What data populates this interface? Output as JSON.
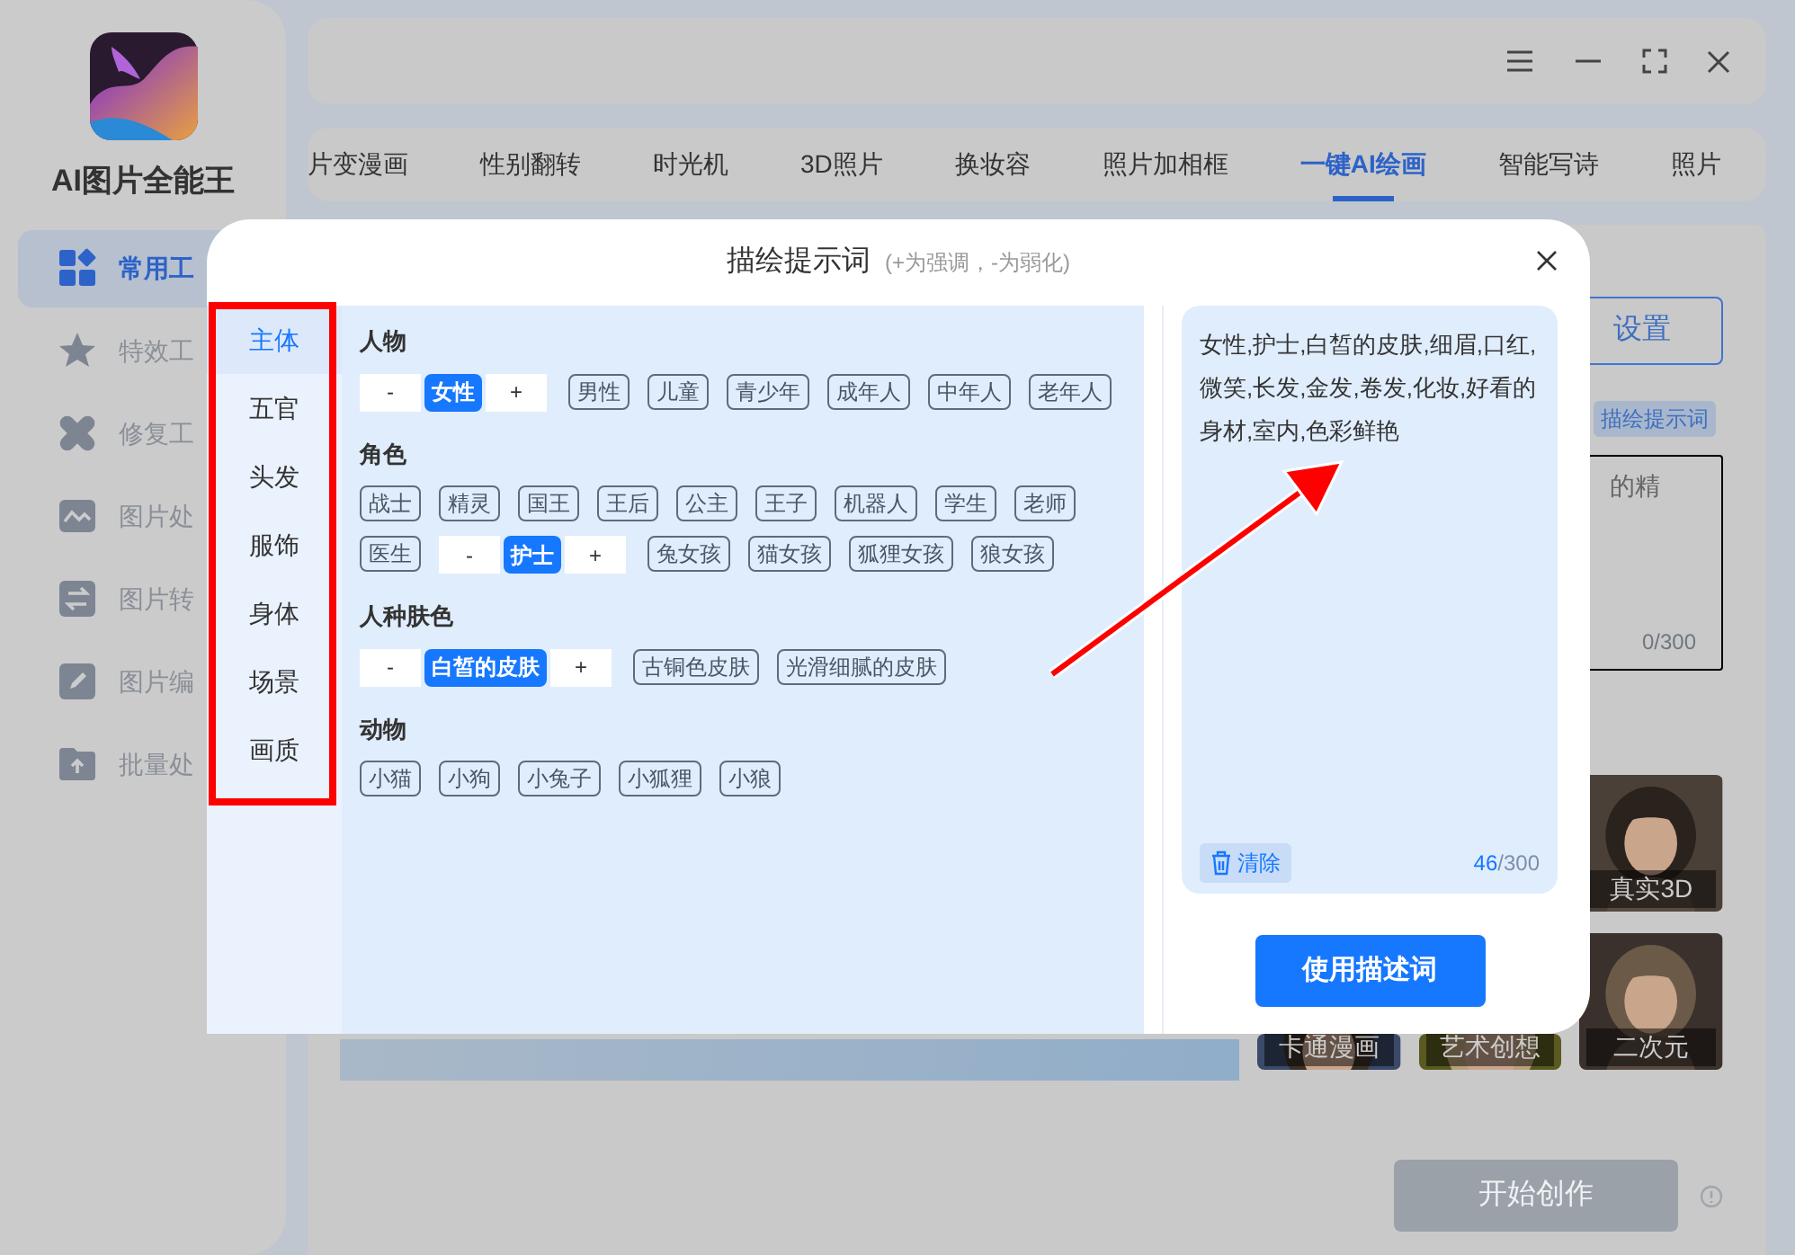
{
  "sidebar": {
    "app_name": "AI图片全能王",
    "items": [
      {
        "label": "常用工",
        "selected": true
      },
      {
        "label": "特效工",
        "selected": false
      },
      {
        "label": "修复工",
        "selected": false
      },
      {
        "label": "图片处",
        "selected": false
      },
      {
        "label": "图片转",
        "selected": false
      },
      {
        "label": "图片编",
        "selected": false
      },
      {
        "label": "批量处",
        "selected": false
      }
    ]
  },
  "tabs": [
    {
      "label": "片变漫画",
      "selected": false
    },
    {
      "label": "性别翻转",
      "selected": false
    },
    {
      "label": "时光机",
      "selected": false
    },
    {
      "label": "3D照片",
      "selected": false
    },
    {
      "label": "换妆容",
      "selected": false
    },
    {
      "label": "照片加相框",
      "selected": false
    },
    {
      "label": "一键AI绘画",
      "selected": true
    },
    {
      "label": "智能写诗",
      "selected": false
    },
    {
      "label": "照片",
      "selected": false
    }
  ],
  "panel": {
    "settings_button": "设置",
    "prompt_tag": "描绘提示词",
    "prompt_text": "的精",
    "counter": "0/300",
    "styles": [
      {
        "label": "真实3D"
      },
      {
        "label": "卡通漫画"
      },
      {
        "label": "艺术创想"
      },
      {
        "label": "二次元"
      }
    ],
    "start_button": {
      "label": "开始创作",
      "disabled": true
    }
  },
  "dialog": {
    "title": "描绘提示词",
    "hint": "(+为强调，-为弱化)",
    "categories": [
      {
        "label": "主体",
        "selected": true
      },
      {
        "label": "五官",
        "selected": false
      },
      {
        "label": "头发",
        "selected": false
      },
      {
        "label": "服饰",
        "selected": false
      },
      {
        "label": "身体",
        "selected": false
      },
      {
        "label": "场景",
        "selected": false
      },
      {
        "label": "画质",
        "selected": false
      }
    ],
    "groups": [
      {
        "title": "人物",
        "items": [
          {
            "label": "女性",
            "selected": true,
            "minus": "-",
            "plus": "+"
          },
          {
            "label": "男性",
            "selected": false
          },
          {
            "label": "儿童",
            "selected": false
          },
          {
            "label": "青少年",
            "selected": false
          },
          {
            "label": "成年人",
            "selected": false
          },
          {
            "label": "中年人",
            "selected": false
          },
          {
            "label": "老年人",
            "selected": false
          }
        ]
      },
      {
        "title": "角色",
        "items": [
          {
            "label": "战士",
            "selected": false
          },
          {
            "label": "精灵",
            "selected": false
          },
          {
            "label": "国王",
            "selected": false
          },
          {
            "label": "王后",
            "selected": false
          },
          {
            "label": "公主",
            "selected": false
          },
          {
            "label": "王子",
            "selected": false
          },
          {
            "label": "机器人",
            "selected": false
          },
          {
            "label": "学生",
            "selected": false
          },
          {
            "label": "老师",
            "selected": false
          },
          {
            "label": "医生",
            "selected": false
          },
          {
            "label": "护士",
            "selected": true,
            "minus": "-",
            "plus": "+"
          },
          {
            "label": "兔女孩",
            "selected": false
          },
          {
            "label": "猫女孩",
            "selected": false
          },
          {
            "label": "狐狸女孩",
            "selected": false
          },
          {
            "label": "狼女孩",
            "selected": false
          }
        ]
      },
      {
        "title": "人种肤色",
        "items": [
          {
            "label": "白皙的皮肤",
            "selected": true,
            "minus": "-",
            "plus": "+"
          },
          {
            "label": "古铜色皮肤",
            "selected": false
          },
          {
            "label": "光滑细腻的皮肤",
            "selected": false
          }
        ]
      },
      {
        "title": "动物",
        "items": [
          {
            "label": "小猫",
            "selected": false
          },
          {
            "label": "小狗",
            "selected": false
          },
          {
            "label": "小兔子",
            "selected": false
          },
          {
            "label": "小狐狸",
            "selected": false
          },
          {
            "label": "小狼",
            "selected": false
          }
        ]
      }
    ],
    "prompt": {
      "value": "女性,护士,白皙的皮肤,细眉,口红,微笑,长发,金发,卷发,化妆,好看的身材,室内,色彩鲜艳",
      "clear": "清除",
      "count": "46",
      "limit": "/300"
    },
    "apply_button": "使用描述词"
  }
}
